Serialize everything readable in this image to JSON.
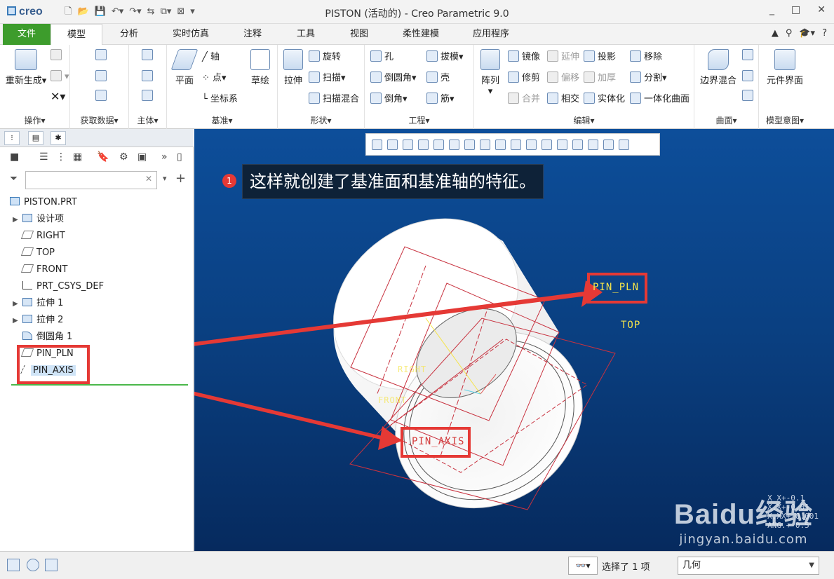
{
  "window": {
    "app_logo": "creo",
    "title": "PISTON (活动的) - Creo Parametric 9.0",
    "controls": [
      "_",
      "□",
      "✕"
    ]
  },
  "quick_access": [
    "new-icon",
    "open-icon",
    "save-icon",
    "undo-icon",
    "redo-icon",
    "regenerate-icon",
    "windows-icon",
    "close-window-icon"
  ],
  "tabs": [
    "文件",
    "模型",
    "分析",
    "实时仿真",
    "注释",
    "工具",
    "视图",
    "柔性建模",
    "应用程序"
  ],
  "active_tab": "模型",
  "ribbon": {
    "operations": {
      "label": "操作",
      "regenerate": "重新生成"
    },
    "get_data": {
      "label": "获取数据"
    },
    "body": {
      "label": "主体"
    },
    "datum": {
      "label": "基准",
      "plane": "平面",
      "axis": "轴",
      "point": "点",
      "csys": "坐标系",
      "sketch": "草绘"
    },
    "shapes": {
      "label": "形状",
      "extrude": "拉伸",
      "revolve": "旋转",
      "sweep": "扫描",
      "swept_blend": "扫描混合"
    },
    "engineering": {
      "label": "工程",
      "hole": "孔",
      "round": "倒圆角",
      "chamfer": "倒角",
      "draft": "拔模",
      "shell": "壳",
      "rib": "筋"
    },
    "editing": {
      "label": "编辑",
      "pattern": "阵列",
      "mirror": "镜像",
      "trim": "修剪",
      "merge": "合并",
      "extend": "延伸",
      "offset": "偏移",
      "intersect": "相交",
      "project": "投影",
      "thicken": "加厚",
      "solidify": "实体化",
      "remove": "移除",
      "split": "分割",
      "unify": "一体化曲面"
    },
    "surfaces": {
      "label": "曲面",
      "boundary_blend": "边界混合"
    },
    "model_intent": {
      "label": "模型意图",
      "component_interface": "元件界面"
    }
  },
  "model_tree": {
    "filter_placeholder": "",
    "items": [
      {
        "label": "PISTON.PRT",
        "icon": "part-icon"
      },
      {
        "label": "设计项",
        "icon": "design-items-icon"
      },
      {
        "label": "RIGHT",
        "icon": "datum-plane-icon"
      },
      {
        "label": "TOP",
        "icon": "datum-plane-icon"
      },
      {
        "label": "FRONT",
        "icon": "datum-plane-icon"
      },
      {
        "label": "PRT_CSYS_DEF",
        "icon": "csys-icon"
      },
      {
        "label": "拉伸 1",
        "icon": "extrude-icon"
      },
      {
        "label": "拉伸 2",
        "icon": "extrude-icon"
      },
      {
        "label": "倒圆角 1",
        "icon": "round-icon"
      },
      {
        "label": "PIN_PLN",
        "icon": "datum-plane-icon"
      },
      {
        "label": "PIN_AXIS",
        "icon": "datum-axis-icon"
      }
    ]
  },
  "viewport": {
    "callout_number": "1",
    "callout_text": "这样就创建了基准面和基准轴的特征。",
    "labels": {
      "pin_pln": "PIN_PLN",
      "top": "TOP",
      "right": "RIGHT",
      "front": "FRONT",
      "pin_axis": "PIN_AXIS"
    },
    "coords": [
      "X X+-0.1",
      "X.X+-0.01",
      "X.XX+-0.001",
      "ANG.+-0.5"
    ],
    "watermark": "Baidu经验",
    "watermark_url": "jingyan.baidu.com",
    "colors": {
      "background_top": "#0d4e9a",
      "background_bottom": "#062a5e",
      "highlight": "#e53935",
      "datum": "#d43a3a",
      "label_yellow": "#f5e44a"
    }
  },
  "status": {
    "selection": "选择了 1 项",
    "filter_value": "几何"
  }
}
